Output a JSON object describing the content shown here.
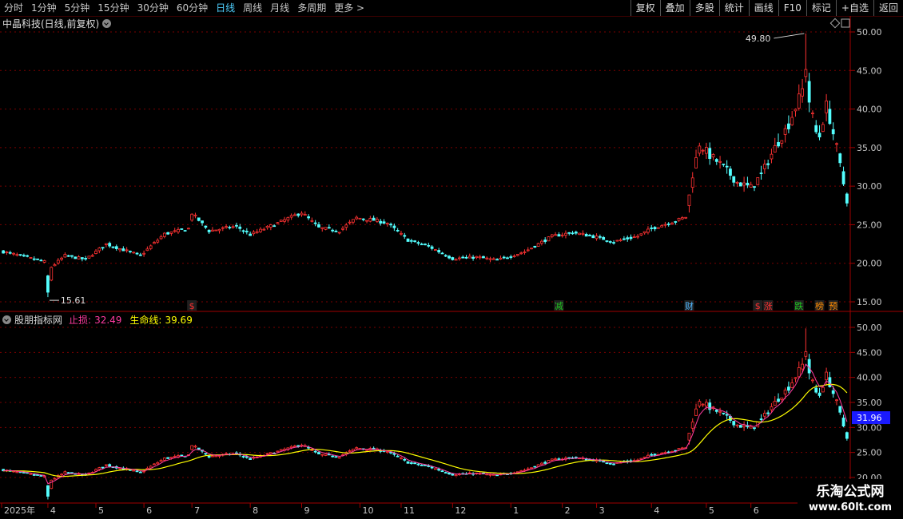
{
  "toolbar": {
    "periods": [
      "分时",
      "1分钟",
      "5分钟",
      "15分钟",
      "30分钟",
      "60分钟",
      "日线",
      "周线",
      "月线",
      "多周期",
      "更多"
    ],
    "active_period": "日线",
    "buttons": [
      "复权",
      "叠加",
      "多股",
      "统计",
      "画线",
      "F10",
      "标记",
      "+自选",
      "返回"
    ]
  },
  "main_panel": {
    "title": "中晶科技(日线,前复权)",
    "high_label": "49.80",
    "low_label": "15.61",
    "event_markers": [
      {
        "text": "$",
        "date_index": 55,
        "color": "#ff3030"
      },
      {
        "text": "减",
        "date_index": 162,
        "color": "#1ec81e"
      },
      {
        "text": "财",
        "date_index": 200,
        "color": "#4fb6ff"
      },
      {
        "text": "$",
        "date_index": 220,
        "color": "#ff3030"
      },
      {
        "text": "涨",
        "date_index": 223,
        "color": "#ff3030"
      },
      {
        "text": "跌",
        "date_index": 232,
        "color": "#1ec81e"
      },
      {
        "text": "榜",
        "date_index": 238,
        "color": "#ff8c00"
      },
      {
        "text": "预",
        "date_index": 242,
        "color": "#ff8c00"
      }
    ]
  },
  "indicator_panel": {
    "name": "股朋指标网",
    "stop_loss_label": "止损:",
    "stop_loss_value": "32.49",
    "lifeline_label": "生命线:",
    "lifeline_value": "39.69",
    "current_value": "31.96"
  },
  "x_axis": {
    "labels": [
      {
        "text": "2025年",
        "date_index": 0
      },
      {
        "text": "4",
        "date_index": 13
      },
      {
        "text": "5",
        "date_index": 27
      },
      {
        "text": "6",
        "date_index": 41
      },
      {
        "text": "7",
        "date_index": 55
      },
      {
        "text": "8",
        "date_index": 72
      },
      {
        "text": "9",
        "date_index": 87
      },
      {
        "text": "10",
        "date_index": 104
      },
      {
        "text": "11",
        "date_index": 116
      },
      {
        "text": "12",
        "date_index": 131
      },
      {
        "text": "1",
        "date_index": 148
      },
      {
        "text": "2",
        "date_index": 163
      },
      {
        "text": "3",
        "date_index": 173
      },
      {
        "text": "4",
        "date_index": 189
      },
      {
        "text": "5",
        "date_index": 205
      },
      {
        "text": "6",
        "date_index": 218
      }
    ]
  },
  "watermark": {
    "line1": "乐淘公式网",
    "line2": "www.60lt.com"
  },
  "colors": {
    "up": "#ff3232",
    "down": "#54ffff",
    "ma_red": "#ff3ba0",
    "lifeline": "#ffff00",
    "grid": "#7a0000",
    "axis": "#a00000",
    "badge": "#1a1aff"
  },
  "chart_data": {
    "type": "candlestick",
    "count": 247,
    "main_y_ticks": [
      15.0,
      20.0,
      25.0,
      30.0,
      35.0,
      40.0,
      45.0,
      50.0
    ],
    "main_ylim": [
      13.6,
      52.0
    ],
    "indicator_y_ticks": [
      20.0,
      25.0,
      30.0,
      35.0,
      40.0,
      45.0,
      50.0
    ],
    "indicator_ylim": [
      19.0,
      52.5
    ],
    "keypoints": [
      [
        0,
        21.5
      ],
      [
        12,
        20.2
      ],
      [
        13,
        16.2
      ],
      [
        14,
        19.5
      ],
      [
        18,
        21.0
      ],
      [
        24,
        20.5
      ],
      [
        30,
        22.5
      ],
      [
        40,
        21.0
      ],
      [
        47,
        23.8
      ],
      [
        54,
        24.5
      ],
      [
        55,
        26.5
      ],
      [
        60,
        24.2
      ],
      [
        68,
        24.8
      ],
      [
        72,
        23.7
      ],
      [
        80,
        25.2
      ],
      [
        87,
        26.6
      ],
      [
        92,
        24.6
      ],
      [
        98,
        24.2
      ],
      [
        103,
        25.9
      ],
      [
        108,
        25.6
      ],
      [
        112,
        25.2
      ],
      [
        118,
        23.0
      ],
      [
        124,
        22.2
      ],
      [
        131,
        20.6
      ],
      [
        138,
        20.8
      ],
      [
        144,
        20.4
      ],
      [
        152,
        21.5
      ],
      [
        160,
        23.5
      ],
      [
        166,
        24.0
      ],
      [
        173,
        23.4
      ],
      [
        178,
        22.8
      ],
      [
        185,
        23.5
      ],
      [
        189,
        24.5
      ],
      [
        196,
        25.5
      ],
      [
        199,
        26.0
      ],
      [
        201,
        31.5
      ],
      [
        203,
        35.5
      ],
      [
        206,
        34.0
      ],
      [
        210,
        32.5
      ],
      [
        214,
        30.5
      ],
      [
        218,
        29.8
      ],
      [
        221,
        31.5
      ],
      [
        225,
        35.0
      ],
      [
        229,
        38.0
      ],
      [
        233,
        42.5
      ],
      [
        234,
        45.5
      ],
      [
        235,
        41.0
      ],
      [
        237,
        37.0
      ],
      [
        238,
        36.5
      ],
      [
        240,
        40.5
      ],
      [
        243,
        35.0
      ],
      [
        246,
        28.0
      ]
    ]
  }
}
